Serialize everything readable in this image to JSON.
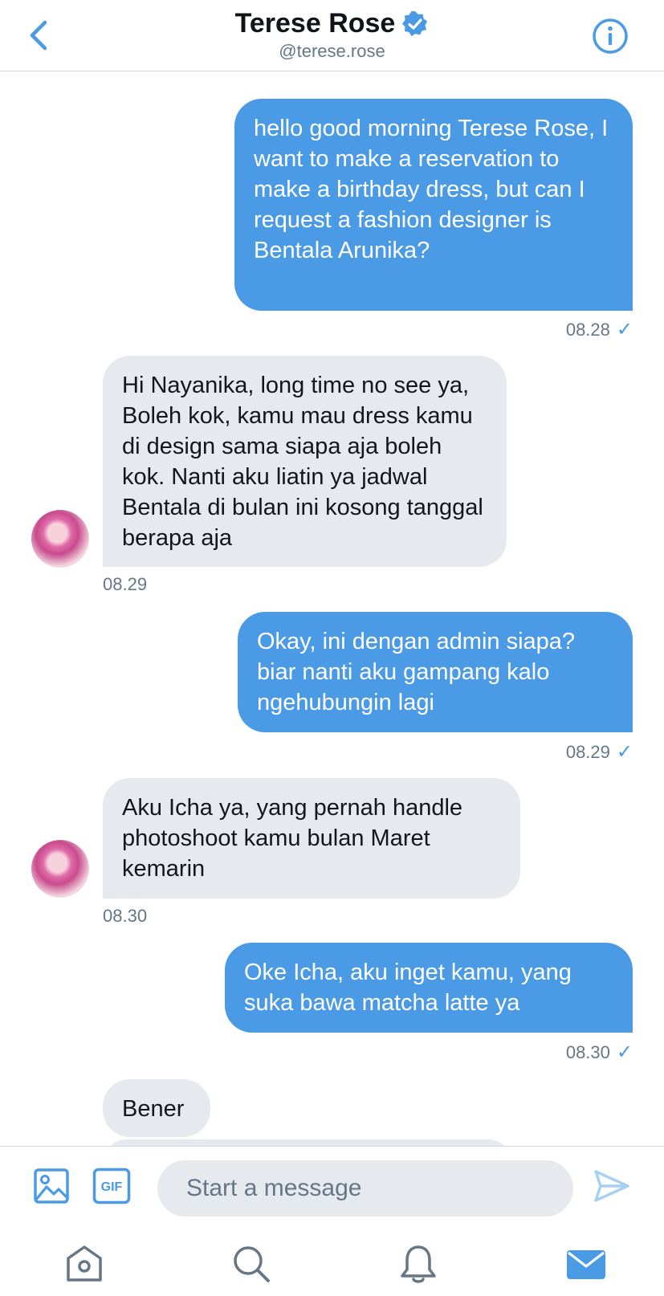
{
  "header": {
    "name": "Terese Rose",
    "handle": "@terese.rose"
  },
  "messages": [
    {
      "direction": "out",
      "text": "hello good morning Terese Rose, I want to make a reservation to make a birthday dress, but can I request a fashion designer is Bentala Arunika?",
      "time": "08.28",
      "status_icon": "check-icon"
    },
    {
      "direction": "in",
      "text": "Hi Nayanika, long time no see ya, Boleh kok, kamu mau dress kamu di design sama siapa aja boleh kok. Nanti aku liatin ya jadwal Bentala di bulan ini kosong tanggal berapa aja",
      "time": "08.29"
    },
    {
      "direction": "out",
      "text": "Okay, ini dengan admin siapa? biar nanti aku gampang kalo ngehubungin lagi",
      "time": "08.29",
      "status_icon": "check-icon"
    },
    {
      "direction": "in",
      "text": "Aku Icha ya, yang pernah handle photoshoot kamu bulan Maret kemarin",
      "time": "08.30"
    },
    {
      "direction": "out",
      "text": "Oke Icha, aku inget kamu, yang suka bawa matcha latte ya",
      "time": "08.30",
      "status_icon": "check-icon"
    },
    {
      "direction": "in",
      "text": "Bener"
    }
  ],
  "composer": {
    "placeholder": "Start a message",
    "gif_label": "GIF",
    "icons": [
      "image-icon",
      "gif-icon",
      "send-icon"
    ]
  },
  "tabbar": {
    "icons": [
      "home-icon",
      "search-icon",
      "bell-icon",
      "mail-icon"
    ],
    "active": "mail-icon"
  },
  "colors": {
    "accent": "#4a9ae6",
    "incoming_bubble": "#e6e9ee",
    "secondary_text": "#657786"
  },
  "check_glyph": "✓"
}
